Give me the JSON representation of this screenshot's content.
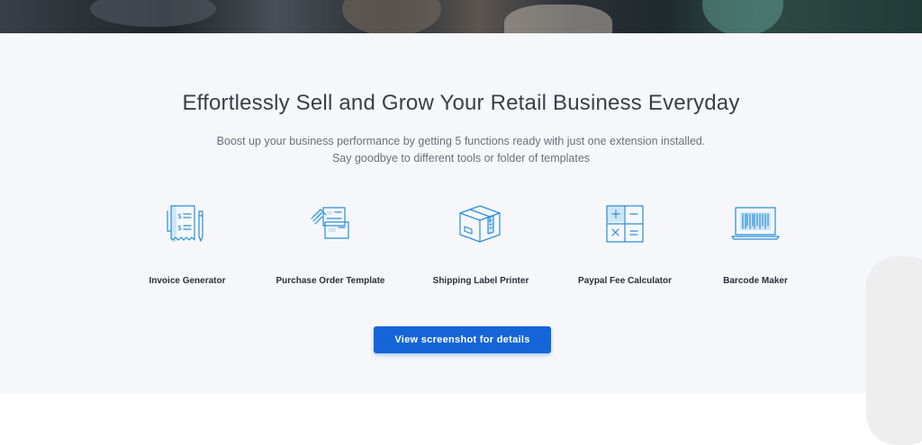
{
  "section": {
    "headline": "Effortlessly Sell and Grow Your Retail Business Everyday",
    "subtext_line1": "Boost up your business performance by getting 5 functions ready with just one extension installed.",
    "subtext_line2": "Say goodbye to different tools or folder of templates"
  },
  "features": [
    {
      "label": "Invoice Generator",
      "icon": "invoice-icon"
    },
    {
      "label": "Purchase Order Template",
      "icon": "purchase-order-icon"
    },
    {
      "label": "Shipping Label Printer",
      "icon": "shipping-box-icon"
    },
    {
      "label": "Paypal Fee Calculator",
      "icon": "calculator-icon"
    },
    {
      "label": "Barcode Maker",
      "icon": "barcode-laptop-icon"
    }
  ],
  "cta": {
    "label": "View screenshot for details"
  },
  "colors": {
    "accent": "#1565d8",
    "icon_stroke": "#2a8ed6",
    "icon_fill": "#cfe6f7",
    "section_bg": "#f6f7fb"
  }
}
